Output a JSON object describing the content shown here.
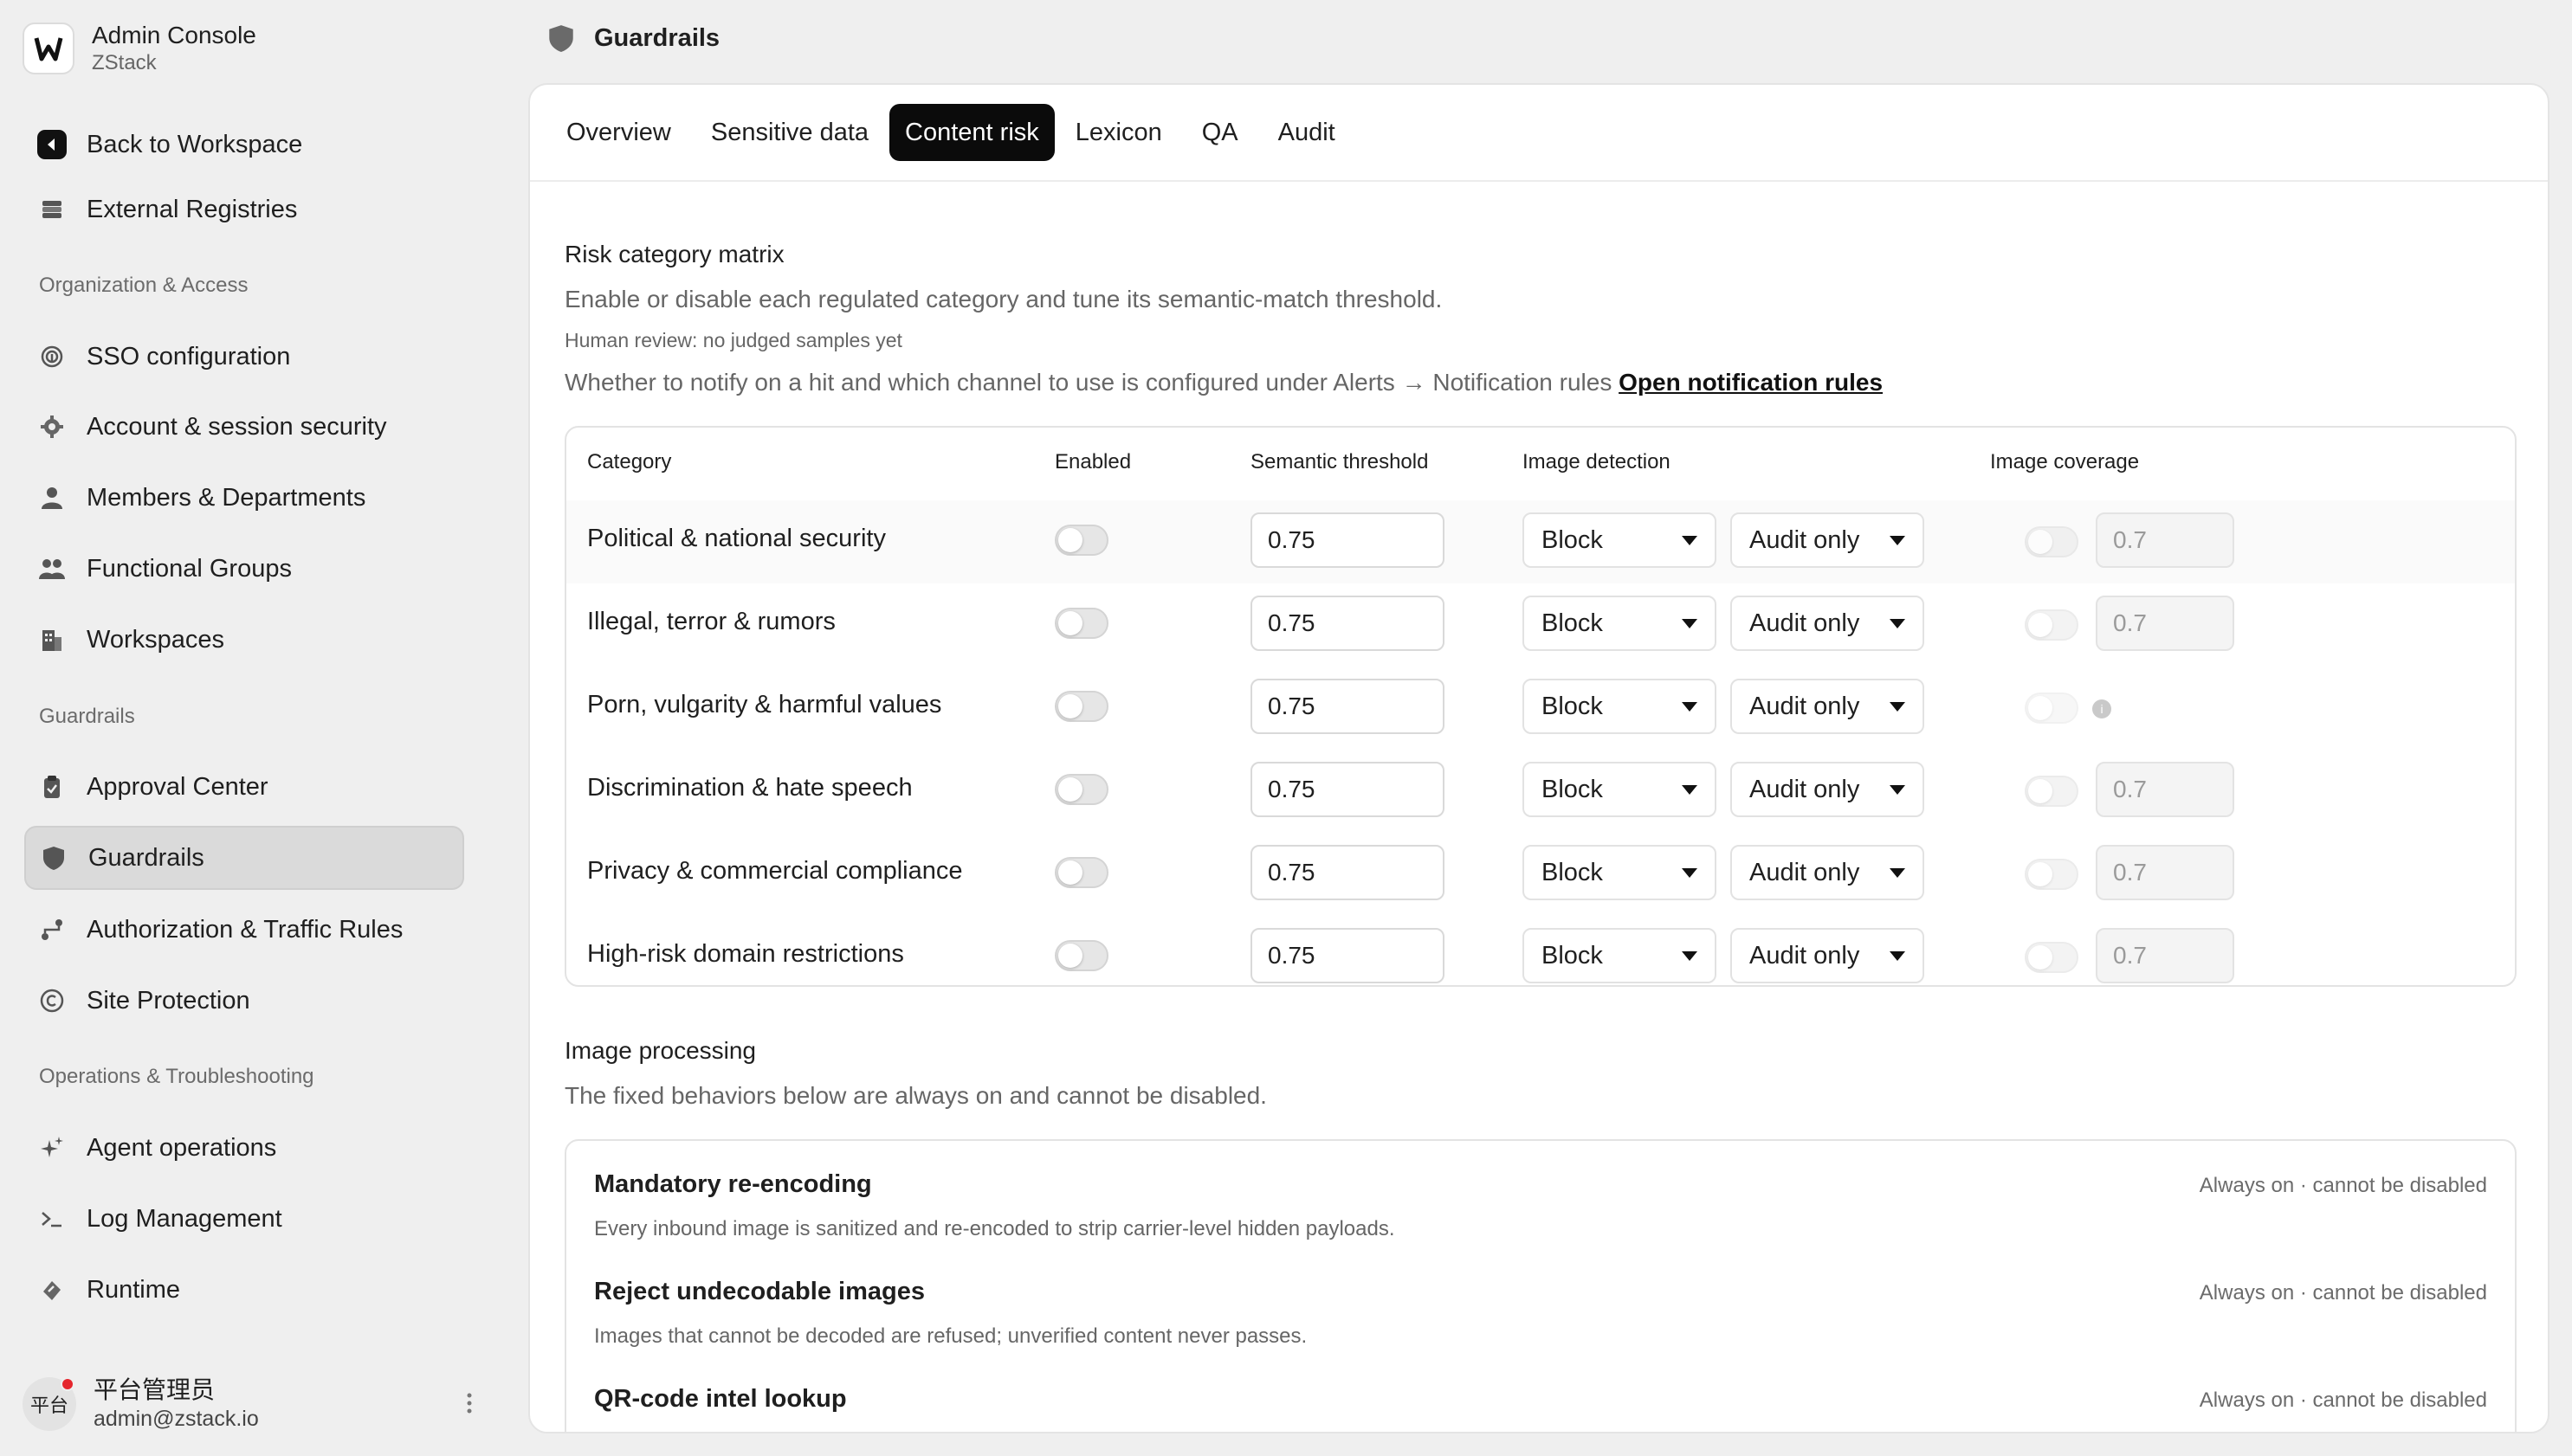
{
  "brand": {
    "title": "Admin Console",
    "subtitle": "ZStack"
  },
  "sidebar": {
    "top_items": [
      {
        "label": "Back to Workspace",
        "icon": "back-circle-icon"
      },
      {
        "label": "External Registries",
        "icon": "database-icon"
      }
    ],
    "sections": [
      {
        "title": "Organization & Access",
        "items": [
          {
            "label": "SSO configuration",
            "icon": "fingerprint-icon"
          },
          {
            "label": "Account & session security",
            "icon": "gear-icon"
          },
          {
            "label": "Members & Departments",
            "icon": "user-icon"
          },
          {
            "label": "Functional Groups",
            "icon": "users-icon"
          },
          {
            "label": "Workspaces",
            "icon": "building-icon"
          }
        ]
      },
      {
        "title": "Guardrails",
        "items": [
          {
            "label": "Approval Center",
            "icon": "clipboard-icon"
          },
          {
            "label": "Guardrails",
            "icon": "shield-icon",
            "active": true
          },
          {
            "label": "Authorization & Traffic Rules",
            "icon": "route-icon"
          },
          {
            "label": "Site Protection",
            "icon": "copyright-icon"
          }
        ]
      },
      {
        "title": "Operations & Troubleshooting",
        "items": [
          {
            "label": "Agent operations",
            "icon": "sparkle-icon"
          },
          {
            "label": "Log Management",
            "icon": "terminal-icon"
          },
          {
            "label": "Runtime",
            "icon": "runtime-icon"
          }
        ]
      }
    ],
    "user": {
      "avatar_text": "平台",
      "name": "平台管理员",
      "email": "admin@zstack.io"
    }
  },
  "header": {
    "title": "Guardrails"
  },
  "tabs": [
    "Overview",
    "Sensitive data",
    "Content risk",
    "Lexicon",
    "QA",
    "Audit"
  ],
  "active_tab": "Content risk",
  "risk_matrix": {
    "title": "Risk category matrix",
    "description": "Enable or disable each regulated category and tune its semantic-match threshold.",
    "note": "Human review: no judged samples yet",
    "notify_text": "Whether to notify on a hit and which channel to use is configured under Alerts → Notification rules",
    "notify_link": "Open notification rules",
    "columns": {
      "category": "Category",
      "enabled": "Enabled",
      "threshold": "Semantic threshold",
      "image_detection": "Image detection",
      "image_coverage": "Image coverage"
    },
    "rows": [
      {
        "category": "Political & national security",
        "enabled": false,
        "threshold": "0.75",
        "action": "Block",
        "image_action": "Audit only",
        "coverage": "0.7"
      },
      {
        "category": "Illegal, terror & rumors",
        "enabled": false,
        "threshold": "0.75",
        "action": "Block",
        "image_action": "Audit only",
        "coverage": "0.7"
      },
      {
        "category": "Porn, vulgarity & harmful values",
        "enabled": false,
        "threshold": "0.75",
        "action": "Block",
        "image_action": "Audit only",
        "coverage": ""
      },
      {
        "category": "Discrimination & hate speech",
        "enabled": false,
        "threshold": "0.75",
        "action": "Block",
        "image_action": "Audit only",
        "coverage": "0.7"
      },
      {
        "category": "Privacy & commercial compliance",
        "enabled": false,
        "threshold": "0.75",
        "action": "Block",
        "image_action": "Audit only",
        "coverage": "0.7"
      },
      {
        "category": "High-risk domain restrictions",
        "enabled": false,
        "threshold": "0.75",
        "action": "Block",
        "image_action": "Audit only",
        "coverage": "0.7"
      }
    ]
  },
  "image_processing": {
    "title": "Image processing",
    "description": "The fixed behaviors below are always on and cannot be disabled.",
    "items": [
      {
        "title": "Mandatory re-encoding",
        "description": "Every inbound image is sanitized and re-encoded to strip carrier-level hidden payloads.",
        "status": "Always on · cannot be disabled"
      },
      {
        "title": "Reject undecodable images",
        "description": "Images that cannot be decoded are refused; unverified content never passes.",
        "status": "Always on · cannot be disabled"
      },
      {
        "title": "QR-code intel lookup",
        "description": "",
        "status": "Always on · cannot be disabled"
      }
    ]
  }
}
